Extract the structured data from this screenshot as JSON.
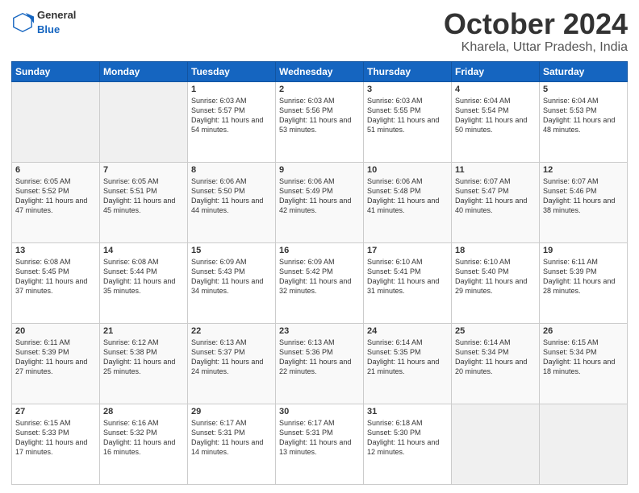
{
  "header": {
    "logo_line1": "General",
    "logo_line2": "Blue",
    "month": "October 2024",
    "location": "Kharela, Uttar Pradesh, India"
  },
  "weekdays": [
    "Sunday",
    "Monday",
    "Tuesday",
    "Wednesday",
    "Thursday",
    "Friday",
    "Saturday"
  ],
  "weeks": [
    [
      {
        "day": "",
        "info": ""
      },
      {
        "day": "",
        "info": ""
      },
      {
        "day": "1",
        "info": "Sunrise: 6:03 AM\nSunset: 5:57 PM\nDaylight: 11 hours and 54 minutes."
      },
      {
        "day": "2",
        "info": "Sunrise: 6:03 AM\nSunset: 5:56 PM\nDaylight: 11 hours and 53 minutes."
      },
      {
        "day": "3",
        "info": "Sunrise: 6:03 AM\nSunset: 5:55 PM\nDaylight: 11 hours and 51 minutes."
      },
      {
        "day": "4",
        "info": "Sunrise: 6:04 AM\nSunset: 5:54 PM\nDaylight: 11 hours and 50 minutes."
      },
      {
        "day": "5",
        "info": "Sunrise: 6:04 AM\nSunset: 5:53 PM\nDaylight: 11 hours and 48 minutes."
      }
    ],
    [
      {
        "day": "6",
        "info": "Sunrise: 6:05 AM\nSunset: 5:52 PM\nDaylight: 11 hours and 47 minutes."
      },
      {
        "day": "7",
        "info": "Sunrise: 6:05 AM\nSunset: 5:51 PM\nDaylight: 11 hours and 45 minutes."
      },
      {
        "day": "8",
        "info": "Sunrise: 6:06 AM\nSunset: 5:50 PM\nDaylight: 11 hours and 44 minutes."
      },
      {
        "day": "9",
        "info": "Sunrise: 6:06 AM\nSunset: 5:49 PM\nDaylight: 11 hours and 42 minutes."
      },
      {
        "day": "10",
        "info": "Sunrise: 6:06 AM\nSunset: 5:48 PM\nDaylight: 11 hours and 41 minutes."
      },
      {
        "day": "11",
        "info": "Sunrise: 6:07 AM\nSunset: 5:47 PM\nDaylight: 11 hours and 40 minutes."
      },
      {
        "day": "12",
        "info": "Sunrise: 6:07 AM\nSunset: 5:46 PM\nDaylight: 11 hours and 38 minutes."
      }
    ],
    [
      {
        "day": "13",
        "info": "Sunrise: 6:08 AM\nSunset: 5:45 PM\nDaylight: 11 hours and 37 minutes."
      },
      {
        "day": "14",
        "info": "Sunrise: 6:08 AM\nSunset: 5:44 PM\nDaylight: 11 hours and 35 minutes."
      },
      {
        "day": "15",
        "info": "Sunrise: 6:09 AM\nSunset: 5:43 PM\nDaylight: 11 hours and 34 minutes."
      },
      {
        "day": "16",
        "info": "Sunrise: 6:09 AM\nSunset: 5:42 PM\nDaylight: 11 hours and 32 minutes."
      },
      {
        "day": "17",
        "info": "Sunrise: 6:10 AM\nSunset: 5:41 PM\nDaylight: 11 hours and 31 minutes."
      },
      {
        "day": "18",
        "info": "Sunrise: 6:10 AM\nSunset: 5:40 PM\nDaylight: 11 hours and 29 minutes."
      },
      {
        "day": "19",
        "info": "Sunrise: 6:11 AM\nSunset: 5:39 PM\nDaylight: 11 hours and 28 minutes."
      }
    ],
    [
      {
        "day": "20",
        "info": "Sunrise: 6:11 AM\nSunset: 5:39 PM\nDaylight: 11 hours and 27 minutes."
      },
      {
        "day": "21",
        "info": "Sunrise: 6:12 AM\nSunset: 5:38 PM\nDaylight: 11 hours and 25 minutes."
      },
      {
        "day": "22",
        "info": "Sunrise: 6:13 AM\nSunset: 5:37 PM\nDaylight: 11 hours and 24 minutes."
      },
      {
        "day": "23",
        "info": "Sunrise: 6:13 AM\nSunset: 5:36 PM\nDaylight: 11 hours and 22 minutes."
      },
      {
        "day": "24",
        "info": "Sunrise: 6:14 AM\nSunset: 5:35 PM\nDaylight: 11 hours and 21 minutes."
      },
      {
        "day": "25",
        "info": "Sunrise: 6:14 AM\nSunset: 5:34 PM\nDaylight: 11 hours and 20 minutes."
      },
      {
        "day": "26",
        "info": "Sunrise: 6:15 AM\nSunset: 5:34 PM\nDaylight: 11 hours and 18 minutes."
      }
    ],
    [
      {
        "day": "27",
        "info": "Sunrise: 6:15 AM\nSunset: 5:33 PM\nDaylight: 11 hours and 17 minutes."
      },
      {
        "day": "28",
        "info": "Sunrise: 6:16 AM\nSunset: 5:32 PM\nDaylight: 11 hours and 16 minutes."
      },
      {
        "day": "29",
        "info": "Sunrise: 6:17 AM\nSunset: 5:31 PM\nDaylight: 11 hours and 14 minutes."
      },
      {
        "day": "30",
        "info": "Sunrise: 6:17 AM\nSunset: 5:31 PM\nDaylight: 11 hours and 13 minutes."
      },
      {
        "day": "31",
        "info": "Sunrise: 6:18 AM\nSunset: 5:30 PM\nDaylight: 11 hours and 12 minutes."
      },
      {
        "day": "",
        "info": ""
      },
      {
        "day": "",
        "info": ""
      }
    ]
  ]
}
